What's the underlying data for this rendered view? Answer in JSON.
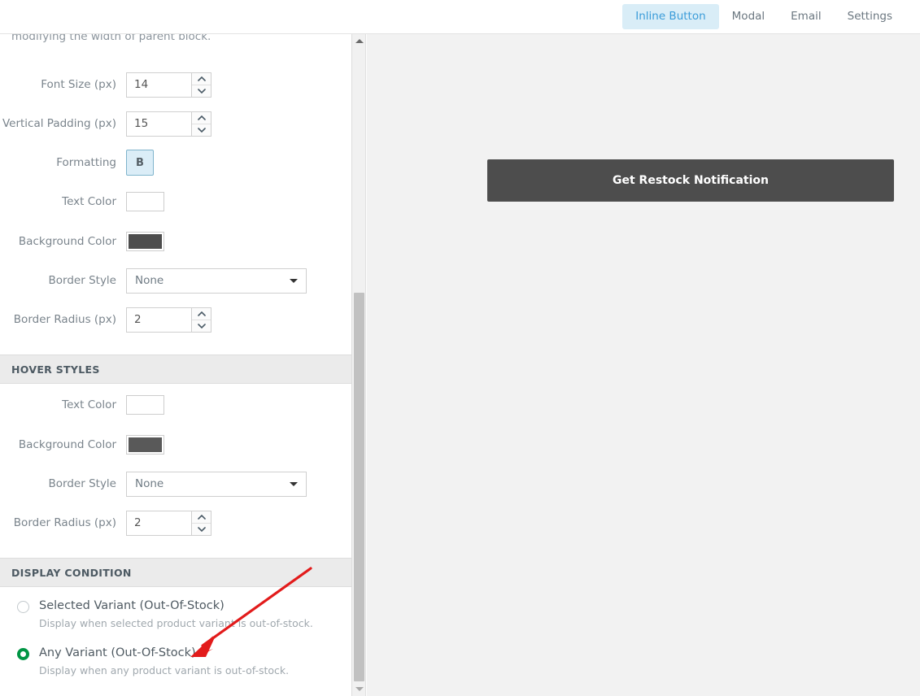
{
  "header": {
    "tabs": [
      {
        "label": "Inline Button",
        "active": true
      },
      {
        "label": "Modal",
        "active": false
      },
      {
        "label": "Email",
        "active": false
      },
      {
        "label": "Settings",
        "active": false
      }
    ]
  },
  "settings_panel": {
    "intro_text": "modifying the width of parent block.",
    "fields": [
      {
        "label": "Font Size (px)",
        "value": "14",
        "type": "spinner"
      },
      {
        "label": "Vertical Padding (px)",
        "value": "15",
        "type": "spinner"
      },
      {
        "label": "Formatting",
        "value": "B",
        "type": "toggle"
      },
      {
        "label": "Text Color",
        "value": "#ffffff",
        "type": "color"
      },
      {
        "label": "Background Color",
        "value": "#4d4d4d",
        "type": "color"
      },
      {
        "label": "Border Style",
        "value": "None",
        "type": "select"
      },
      {
        "label": "Border Radius (px)",
        "value": "2",
        "type": "spinner"
      }
    ],
    "hover_section": {
      "title": "HOVER STYLES",
      "fields": [
        {
          "label": "Text Color",
          "value": "#ffffff",
          "type": "color"
        },
        {
          "label": "Background Color",
          "value": "#595959",
          "type": "color"
        },
        {
          "label": "Border Style",
          "value": "None",
          "type": "select"
        },
        {
          "label": "Border Radius (px)",
          "value": "2",
          "type": "spinner"
        }
      ]
    },
    "display_condition": {
      "title": "DISPLAY CONDITION",
      "options": [
        {
          "title": "Selected Variant (Out-Of-Stock)",
          "description": "Display when selected product variant is out-of-stock.",
          "selected": false
        },
        {
          "title": "Any Variant (Out-Of-Stock)",
          "description": "Display when any product variant is out-of-stock.",
          "selected": true
        }
      ]
    }
  },
  "preview": {
    "button_label": "Get Restock Notification"
  },
  "colors": {
    "accent_blue": "#3b9cd9",
    "tab_active_bg": "#d9edf7",
    "radio_green": "#009544",
    "annotation_red": "#e21b1b",
    "button_dark": "#4d4d4d",
    "preview_bg": "#f2f2f2"
  }
}
